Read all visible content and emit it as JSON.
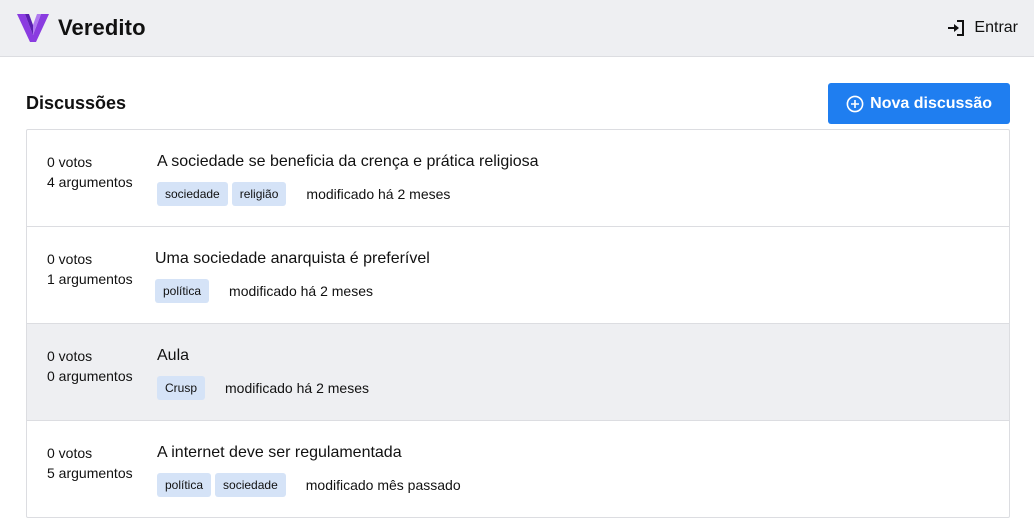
{
  "header": {
    "brand_name": "Veredito",
    "login_label": "Entrar",
    "colors": {
      "logo_purple": "#8a3ce0",
      "logo_dark": "#5a1fb0"
    }
  },
  "section": {
    "title": "Discussões",
    "new_button_label": "Nova discussão",
    "accent_color": "#1f7ef0"
  },
  "discussions": [
    {
      "votes": "0 votos",
      "arguments": "4 argumentos",
      "title": "A sociedade se beneficia da crença e prática religiosa",
      "tags": [
        "sociedade",
        "religião"
      ],
      "modified": "modificado há 2 meses"
    },
    {
      "votes": "0 votos",
      "arguments": "1 argumentos",
      "title": "Uma sociedade anarquista é preferível",
      "tags": [
        "política"
      ],
      "modified": "modificado há 2 meses"
    },
    {
      "votes": "0 votos",
      "arguments": "0 argumentos",
      "title": "Aula",
      "tags": [
        "Crusp"
      ],
      "modified": "modificado há 2 meses"
    },
    {
      "votes": "0 votos",
      "arguments": "5 argumentos",
      "title": "A internet deve ser regulamentada",
      "tags": [
        "política",
        "sociedade"
      ],
      "modified": "modificado mês passado"
    }
  ]
}
